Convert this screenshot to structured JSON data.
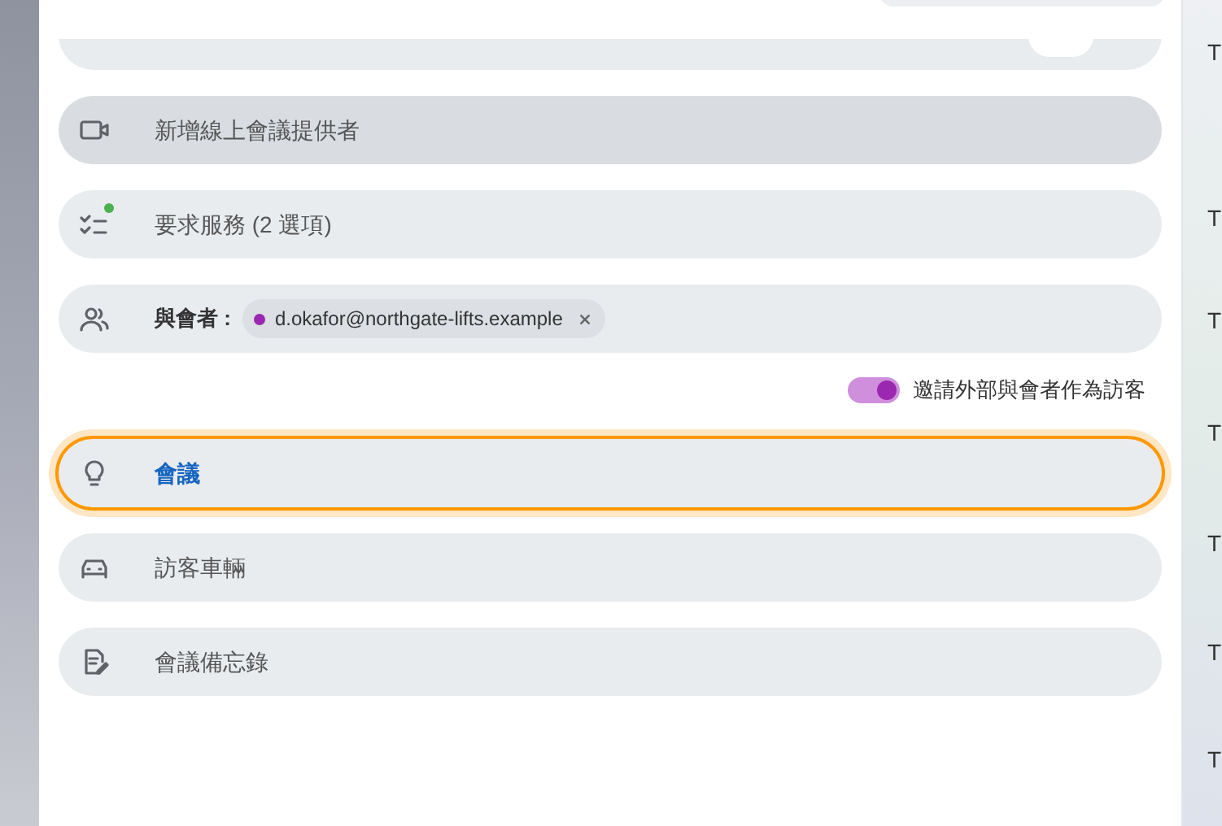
{
  "rows": [
    {
      "kind": "online_meeting",
      "label": "新增線上會議提供者",
      "hovered": true,
      "focused": false
    },
    {
      "kind": "services",
      "label": "要求服務 (2 選項)",
      "notified": true,
      "hovered": false,
      "focused": false
    },
    {
      "kind": "attendees",
      "label": "與會者 :",
      "chips": [
        {
          "text": "d.okafor@northgate-lifts.example",
          "color": "#9c27b0"
        }
      ],
      "hovered": false,
      "focused": false
    },
    {
      "kind": "toggle",
      "label": "邀請外部與會者作為訪客",
      "on": true
    },
    {
      "kind": "meeting",
      "label": "會議",
      "hovered": false,
      "focused": true
    },
    {
      "kind": "vehicle",
      "label": "訪客車輛",
      "hovered": false,
      "focused": false
    },
    {
      "kind": "notes",
      "label": "會議備忘錄",
      "hovered": false,
      "focused": false
    }
  ],
  "side_items": [
    "T",
    "T",
    "T",
    "T",
    "T",
    "T",
    "T"
  ]
}
